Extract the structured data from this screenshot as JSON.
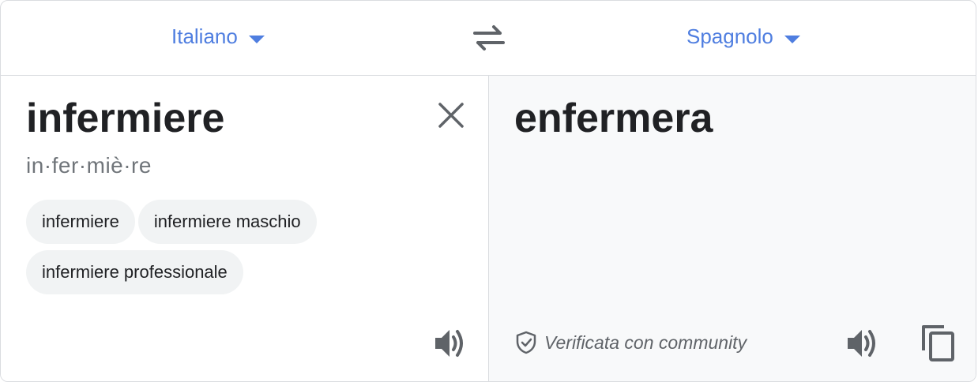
{
  "languages": {
    "source": "Italiano",
    "target": "Spagnolo"
  },
  "source": {
    "text": "infermiere",
    "syllables": "in·fer·miè·re",
    "alternatives": [
      "infermiere",
      "infermiere maschio",
      "infermiere professionale"
    ]
  },
  "target": {
    "text": "enfermera",
    "verified_label": "Verificata con community"
  },
  "icons": {
    "swap": "swap-arrows-icon",
    "clear": "close-icon",
    "speaker": "speaker-icon",
    "verified": "shield-check-icon",
    "copy": "copy-icon"
  },
  "colors": {
    "accent": "#4f7ee0",
    "text": "#202124",
    "muted": "#70757a",
    "chip_bg": "#f1f3f4",
    "result_bg": "#f8f9fa"
  }
}
